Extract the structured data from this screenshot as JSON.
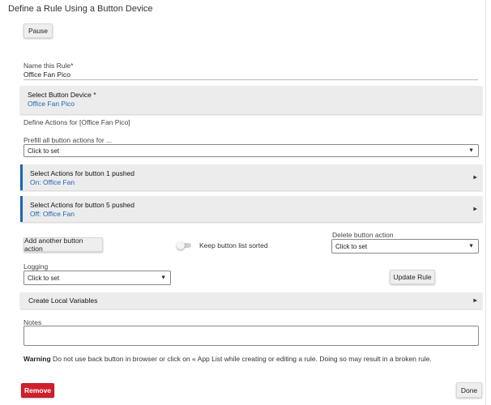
{
  "page": {
    "title": "Define a Rule Using a Button Device"
  },
  "pause": {
    "label": "Pause"
  },
  "name_rule": {
    "label": "Name this Rule*",
    "value": "Office Fan Pico"
  },
  "button_device": {
    "title": "Select Button Device *",
    "value": "Office Fan Pico"
  },
  "define_actions": {
    "label": "Define Actions for [Office Fan Pico]"
  },
  "prefill": {
    "label": "Prefill all button actions for ...",
    "value": "Click to set"
  },
  "actions": [
    {
      "title": "Select Actions for button 1 pushed",
      "summary": "On: Office Fan"
    },
    {
      "title": "Select Actions for button 5 pushed",
      "summary": "Off: Office Fan"
    }
  ],
  "add_action": {
    "label": "Add another button action"
  },
  "keep_sorted": {
    "label": "Keep button list sorted",
    "on": false
  },
  "delete_action": {
    "label": "Delete button action",
    "value": "Click to set"
  },
  "logging": {
    "label": "Logging",
    "value": "Click to set"
  },
  "update_rule": {
    "label": "Update Rule"
  },
  "local_vars": {
    "title": "Create Local Variables"
  },
  "notes": {
    "label": "Notes",
    "value": ""
  },
  "warning": {
    "bold": "Warning",
    "text": " Do not use back button in browser or click on « App List while creating or editing a rule. Doing so may result in a broken rule."
  },
  "remove": {
    "label": "Remove"
  },
  "done": {
    "label": "Done"
  },
  "colors": {
    "accent": "#1f66b5",
    "danger": "#d0202e",
    "panel": "#ececec"
  }
}
